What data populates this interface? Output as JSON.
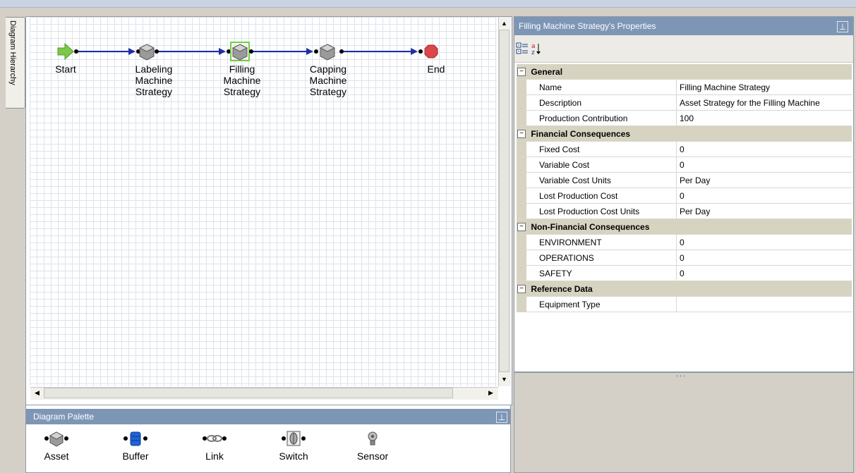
{
  "side_tab": {
    "label": "Diagram Hierarchy"
  },
  "diagram": {
    "nodes": [
      {
        "id": "start",
        "label": "Start",
        "icon": "start-arrow-icon"
      },
      {
        "id": "labeling",
        "label": "Labeling\nMachine\nStrategy",
        "icon": "asset-cube-icon"
      },
      {
        "id": "filling",
        "label": "Filling\nMachine\nStrategy",
        "icon": "asset-cube-icon",
        "selected": true
      },
      {
        "id": "capping",
        "label": "Capping\nMachine\nStrategy",
        "icon": "asset-cube-icon"
      },
      {
        "id": "end",
        "label": "End",
        "icon": "end-stop-icon"
      }
    ],
    "link_color": "#1f2fa8",
    "selection_color": "#6fd13a"
  },
  "palette": {
    "title": "Diagram Palette",
    "items": [
      {
        "label": "Asset",
        "icon": "asset-cube-icon"
      },
      {
        "label": "Buffer",
        "icon": "buffer-drum-icon"
      },
      {
        "label": "Link",
        "icon": "link-chain-icon"
      },
      {
        "label": "Switch",
        "icon": "switch-icon"
      },
      {
        "label": "Sensor",
        "icon": "sensor-icon"
      }
    ]
  },
  "properties": {
    "title": "Filling Machine Strategy's Properties",
    "toolbar": {
      "categorized": "categorized-icon",
      "alphabetical": "sort-az-icon"
    },
    "categories": [
      {
        "name": "General",
        "rows": [
          {
            "name": "Name",
            "value": "Filling Machine Strategy"
          },
          {
            "name": "Description",
            "value": "Asset Strategy for the Filling Machine"
          },
          {
            "name": "Production Contribution",
            "value": "100"
          }
        ]
      },
      {
        "name": "Financial Consequences",
        "rows": [
          {
            "name": "Fixed Cost",
            "value": "0"
          },
          {
            "name": "Variable Cost",
            "value": "0"
          },
          {
            "name": "Variable Cost Units",
            "value": "Per Day"
          },
          {
            "name": "Lost Production Cost",
            "value": "0"
          },
          {
            "name": "Lost Production Cost Units",
            "value": "Per Day"
          }
        ]
      },
      {
        "name": "Non-Financial Consequences",
        "rows": [
          {
            "name": "ENVIRONMENT",
            "value": "0"
          },
          {
            "name": "OPERATIONS",
            "value": "0"
          },
          {
            "name": "SAFETY",
            "value": "0"
          }
        ]
      },
      {
        "name": "Reference Data",
        "rows": [
          {
            "name": "Equipment Type",
            "value": ""
          }
        ]
      }
    ]
  },
  "colors": {
    "panel_header": "#7e96b5",
    "category_bg": "#d7d3c1",
    "start_green": "#7bc84a",
    "end_red": "#d9474a"
  }
}
